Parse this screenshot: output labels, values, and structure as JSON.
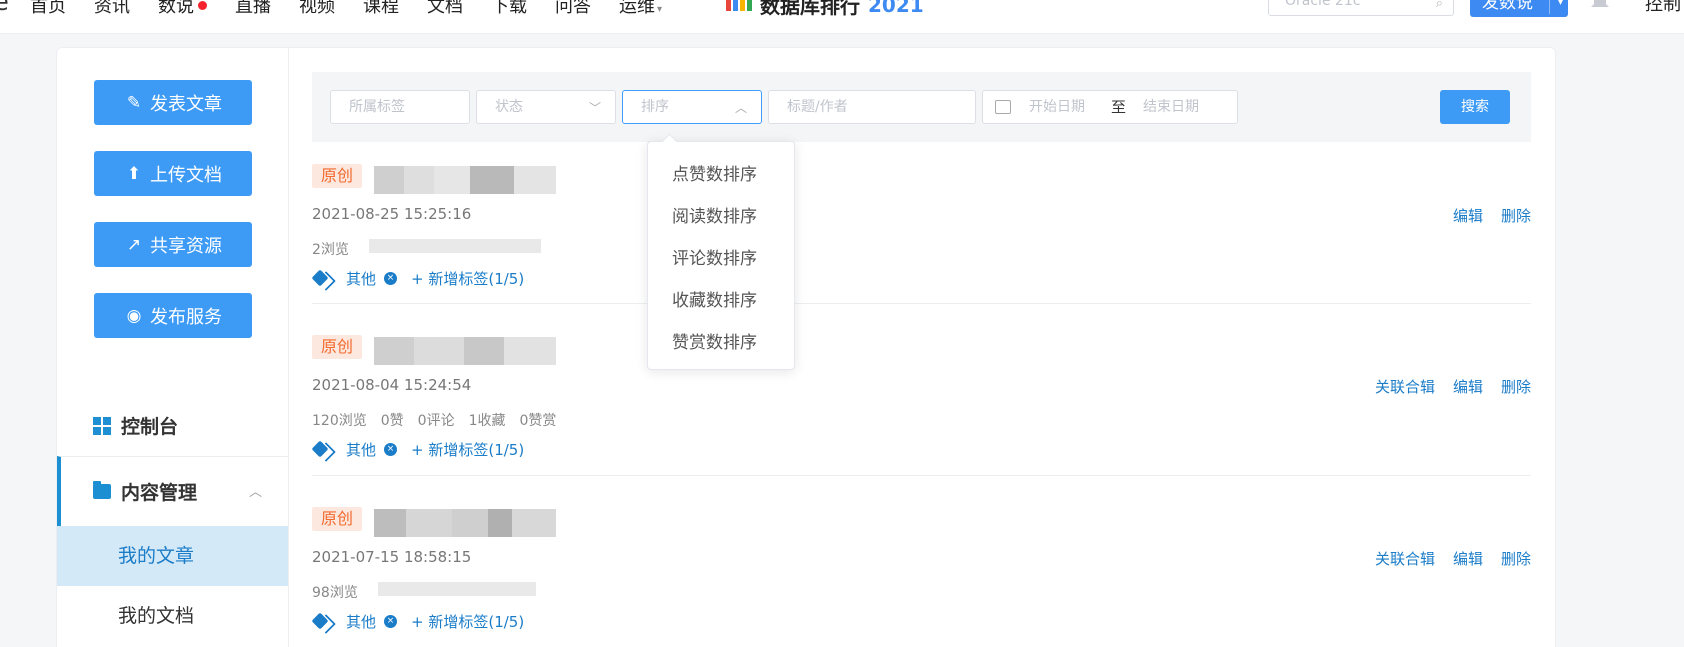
{
  "topnav": {
    "items": [
      {
        "label": "首页"
      },
      {
        "label": "资讯"
      },
      {
        "label": "数说",
        "dot": true
      },
      {
        "label": "直播"
      },
      {
        "label": "视频"
      },
      {
        "label": "课程"
      },
      {
        "label": "文档"
      },
      {
        "label": "下载"
      },
      {
        "label": "问答"
      },
      {
        "label": "运维",
        "caret": true
      }
    ],
    "rank_title": "数据库排行",
    "rank_year": "2021",
    "search_placeholder": "Oracle 21c",
    "publish_btn": "发数说",
    "right_text": "控制"
  },
  "sidebar": {
    "buttons": [
      {
        "label": "发表文章",
        "icon": "document-edit-icon"
      },
      {
        "label": "上传文档",
        "icon": "upload-icon"
      },
      {
        "label": "共享资源",
        "icon": "share-icon"
      },
      {
        "label": "发布服务",
        "icon": "service-icon"
      }
    ],
    "console": "控制台",
    "content_mgmt": "内容管理",
    "sub_items": [
      {
        "label": "我的文章",
        "active": true
      },
      {
        "label": "我的文档",
        "active": false
      }
    ]
  },
  "filter": {
    "tag_placeholder": "所属标签",
    "status_placeholder": "状态",
    "sort_placeholder": "排序",
    "title_placeholder": "标题/作者",
    "start_date": "开始日期",
    "to": "至",
    "end_date": "结束日期",
    "search_btn": "搜索"
  },
  "sort_options": [
    "点赞数排序",
    "阅读数排序",
    "评论数排序",
    "收藏数排序",
    "赞赏数排序"
  ],
  "articles": [
    {
      "tag": "原创",
      "date": "2021-08-25 15:25:16",
      "stats": [
        "2浏览"
      ],
      "category": "其他",
      "add_tag": "+ 新增标签(1/5)",
      "actions": [
        "编辑",
        "删除"
      ]
    },
    {
      "tag": "原创",
      "date": "2021-08-04 15:24:54",
      "stats": [
        "120浏览",
        "0赞",
        "0评论",
        "1收藏",
        "0赞赏"
      ],
      "category": "其他",
      "add_tag": "+ 新增标签(1/5)",
      "actions": [
        "关联合辑",
        "编辑",
        "删除"
      ]
    },
    {
      "tag": "原创",
      "date": "2021-07-15 18:58:15",
      "stats": [
        "98浏览"
      ],
      "category": "其他",
      "add_tag": "+ 新增标签(1/5)",
      "actions": [
        "关联合辑",
        "编辑",
        "删除"
      ]
    }
  ],
  "colors": {
    "accent": "#3d9bf6",
    "link": "#1b7cc8",
    "tag_bg": "#fde8df",
    "tag_text": "#f26a2e",
    "active_bg": "#d3e9f7"
  }
}
